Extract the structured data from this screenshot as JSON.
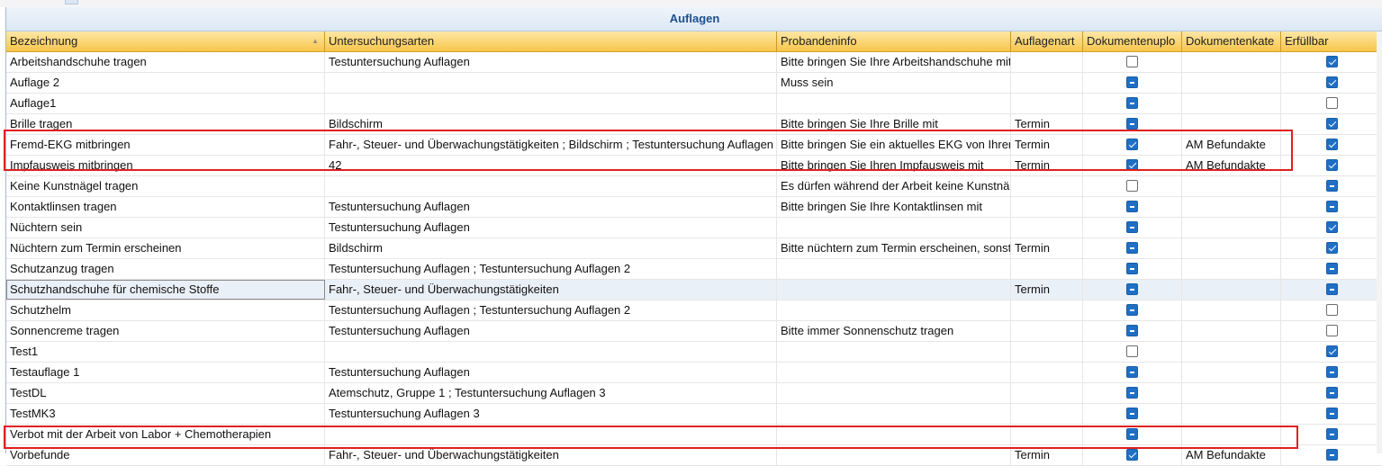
{
  "panel": {
    "title": "Auflagen"
  },
  "columns": [
    "Bezeichnung",
    "Untersuchungsarten",
    "Probandeninfo",
    "Auflagenart",
    "Dokumentenuplo",
    "Dokumentenkate",
    "Erfüllbar"
  ],
  "rows": [
    {
      "bezeichnung": "Arbeitshandschuhe tragen",
      "untersuchungsarten": "Testuntersuchung Auflagen",
      "probandeninfo": "Bitte bringen Sie Ihre Arbeitshandschuhe mit",
      "auflagenart": "",
      "dokumentenupload": "unchecked",
      "dokumentenkategorie": "",
      "erfuellbar": "checked"
    },
    {
      "bezeichnung": "Auflage 2",
      "untersuchungsarten": "",
      "probandeninfo": "Muss sein",
      "auflagenart": "",
      "dokumentenupload": "indeterminate",
      "dokumentenkategorie": "",
      "erfuellbar": "checked"
    },
    {
      "bezeichnung": "Auflage1",
      "untersuchungsarten": "",
      "probandeninfo": "",
      "auflagenart": "",
      "dokumentenupload": "indeterminate",
      "dokumentenkategorie": "",
      "erfuellbar": "unchecked"
    },
    {
      "bezeichnung": "Brille tragen",
      "untersuchungsarten": "Bildschirm",
      "probandeninfo": "Bitte bringen Sie Ihre Brille mit",
      "auflagenart": "Termin",
      "dokumentenupload": "indeterminate",
      "dokumentenkategorie": "",
      "erfuellbar": "checked"
    },
    {
      "bezeichnung": "Fremd-EKG mitbringen",
      "untersuchungsarten": "Fahr-, Steuer- und Überwachungstätigkeiten ; Bildschirm ; Testuntersuchung Auflagen",
      "probandeninfo": "Bitte bringen Sie ein aktuelles EKG von Ihrem Arzt mit",
      "auflagenart": "Termin",
      "dokumentenupload": "checked",
      "dokumentenkategorie": "AM Befundakte",
      "erfuellbar": "checked"
    },
    {
      "bezeichnung": "Impfausweis mitbringen",
      "untersuchungsarten": "42",
      "probandeninfo": "Bitte bringen Sie Ihren Impfausweis mit",
      "auflagenart": "Termin",
      "dokumentenupload": "checked",
      "dokumentenkategorie": "AM Befundakte",
      "erfuellbar": "checked"
    },
    {
      "bezeichnung": "Keine Kunstnägel tragen",
      "untersuchungsarten": "",
      "probandeninfo": "Es dürfen während der Arbeit keine Kunstnägel getragen werden",
      "auflagenart": "",
      "dokumentenupload": "unchecked",
      "dokumentenkategorie": "",
      "erfuellbar": "indeterminate"
    },
    {
      "bezeichnung": "Kontaktlinsen tragen",
      "untersuchungsarten": "Testuntersuchung Auflagen",
      "probandeninfo": "Bitte bringen Sie Ihre Kontaktlinsen mit",
      "auflagenart": "",
      "dokumentenupload": "indeterminate",
      "dokumentenkategorie": "",
      "erfuellbar": "indeterminate"
    },
    {
      "bezeichnung": "Nüchtern sein",
      "untersuchungsarten": "Testuntersuchung Auflagen",
      "probandeninfo": "",
      "auflagenart": "",
      "dokumentenupload": "indeterminate",
      "dokumentenkategorie": "",
      "erfuellbar": "checked"
    },
    {
      "bezeichnung": "Nüchtern zum Termin erscheinen",
      "untersuchungsarten": "Bildschirm",
      "probandeninfo": "Bitte nüchtern zum Termin erscheinen, sonst",
      "auflagenart": "Termin",
      "dokumentenupload": "indeterminate",
      "dokumentenkategorie": "",
      "erfuellbar": "checked"
    },
    {
      "bezeichnung": "Schutzanzug tragen",
      "untersuchungsarten": "Testuntersuchung Auflagen ; Testuntersuchung Auflagen 2",
      "probandeninfo": "",
      "auflagenart": "",
      "dokumentenupload": "indeterminate",
      "dokumentenkategorie": "",
      "erfuellbar": "indeterminate"
    },
    {
      "bezeichnung": "Schutzhandschuhe für chemische Stoffe",
      "untersuchungsarten": "Fahr-, Steuer- und Überwachungstätigkeiten",
      "probandeninfo": "",
      "auflagenart": "Termin",
      "dokumentenupload": "indeterminate",
      "dokumentenkategorie": "",
      "erfuellbar": "indeterminate"
    },
    {
      "bezeichnung": "Schutzhelm",
      "untersuchungsarten": "Testuntersuchung Auflagen ; Testuntersuchung Auflagen 2",
      "probandeninfo": "",
      "auflagenart": "",
      "dokumentenupload": "indeterminate",
      "dokumentenkategorie": "",
      "erfuellbar": "unchecked"
    },
    {
      "bezeichnung": "Sonnencreme tragen",
      "untersuchungsarten": "Testuntersuchung Auflagen",
      "probandeninfo": "Bitte immer Sonnenschutz tragen",
      "auflagenart": "",
      "dokumentenupload": "indeterminate",
      "dokumentenkategorie": "",
      "erfuellbar": "unchecked"
    },
    {
      "bezeichnung": "Test1",
      "untersuchungsarten": "",
      "probandeninfo": "",
      "auflagenart": "",
      "dokumentenupload": "unchecked",
      "dokumentenkategorie": "",
      "erfuellbar": "checked"
    },
    {
      "bezeichnung": "Testauflage 1",
      "untersuchungsarten": "Testuntersuchung Auflagen",
      "probandeninfo": "",
      "auflagenart": "",
      "dokumentenupload": "indeterminate",
      "dokumentenkategorie": "",
      "erfuellbar": "indeterminate"
    },
    {
      "bezeichnung": "TestDL",
      "untersuchungsarten": "Atemschutz, Gruppe 1 ; Testuntersuchung Auflagen 3",
      "probandeninfo": "",
      "auflagenart": "",
      "dokumentenupload": "indeterminate",
      "dokumentenkategorie": "",
      "erfuellbar": "indeterminate"
    },
    {
      "bezeichnung": "TestMK3",
      "untersuchungsarten": "Testuntersuchung Auflagen 3",
      "probandeninfo": "",
      "auflagenart": "",
      "dokumentenupload": "indeterminate",
      "dokumentenkategorie": "",
      "erfuellbar": "indeterminate"
    },
    {
      "bezeichnung": "Verbot mit der Arbeit von Labor + Chemotherapien",
      "untersuchungsarten": "",
      "probandeninfo": "",
      "auflagenart": "",
      "dokumentenupload": "indeterminate",
      "dokumentenkategorie": "",
      "erfuellbar": "indeterminate"
    },
    {
      "bezeichnung": "Vorbefunde",
      "untersuchungsarten": "Fahr-, Steuer- und Überwachungstätigkeiten",
      "probandeninfo": "",
      "auflagenart": "Termin",
      "dokumentenupload": "checked",
      "dokumentenkategorie": "AM Befundakte",
      "erfuellbar": "indeterminate"
    }
  ]
}
